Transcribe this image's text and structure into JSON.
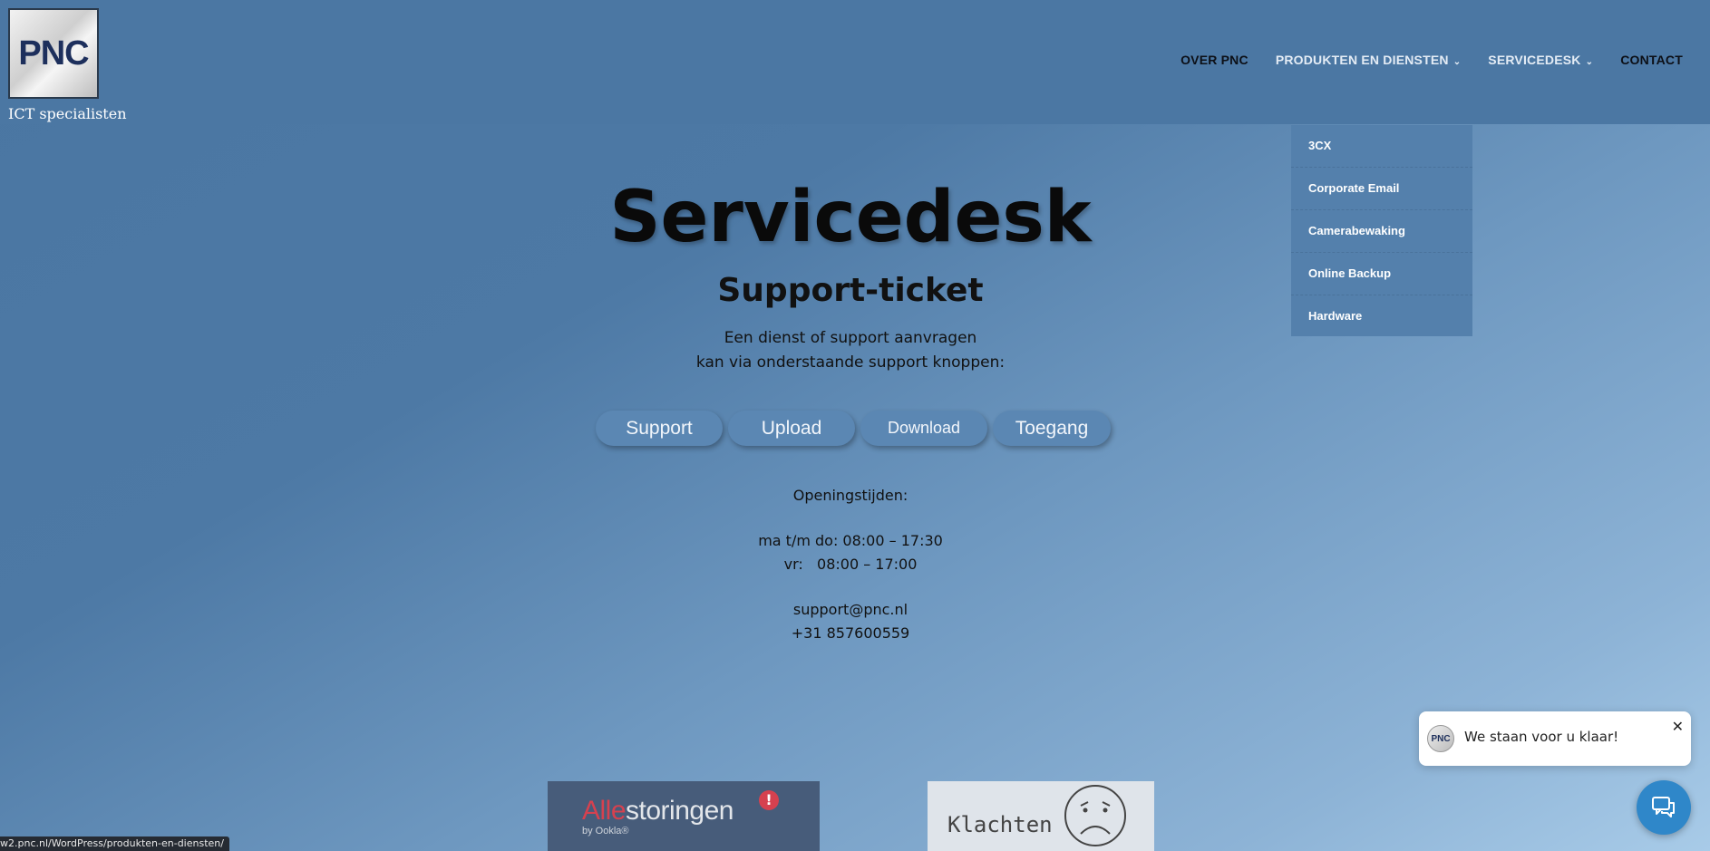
{
  "header": {
    "logo_text": "PNC",
    "tagline": "ICT specialisten"
  },
  "nav": {
    "items": [
      {
        "label": "OVER PNC"
      },
      {
        "label": "PRODUKTEN EN DIENSTEN"
      },
      {
        "label": "SERVICEDESK"
      },
      {
        "label": "CONTACT"
      }
    ]
  },
  "dropdown": {
    "items": [
      {
        "label": "3CX"
      },
      {
        "label": "Corporate Email"
      },
      {
        "label": "Camerabewaking"
      },
      {
        "label": "Online Backup"
      },
      {
        "label": "Hardware"
      }
    ]
  },
  "hero": {
    "title": "Servicedesk",
    "subtitle": "Support-ticket",
    "desc_line1": "Een dienst of support aanvragen",
    "desc_line2": "kan via onderstaande support knoppen:"
  },
  "buttons": {
    "support": "Support",
    "upload": "Upload",
    "download": "Download",
    "toegang": "Toegang"
  },
  "hours": {
    "heading": "Openingstijden:",
    "line1": "ma t/m do: 08:00 – 17:30",
    "line2": "vr:   08:00 – 17:00",
    "email": "support@pnc.nl",
    "phone": "+31 857600559"
  },
  "badges": {
    "alle_part1": "Alle",
    "alle_part2": "storingen",
    "alle_mark": "!",
    "alle_by": "by Ookla®",
    "klachten": "Klachten"
  },
  "chat": {
    "avatar_text": "PNC",
    "message": "We staan voor u klaar!",
    "close": "✕"
  },
  "status_bar": {
    "url": "w2.pnc.nl/WordPress/produkten-en-diensten/"
  },
  "colors": {
    "header_bg": "#4b77a3",
    "dropdown_bg": "#5480ac",
    "button_bg": "#5b87b3",
    "chat_accent": "#2f87c9"
  }
}
